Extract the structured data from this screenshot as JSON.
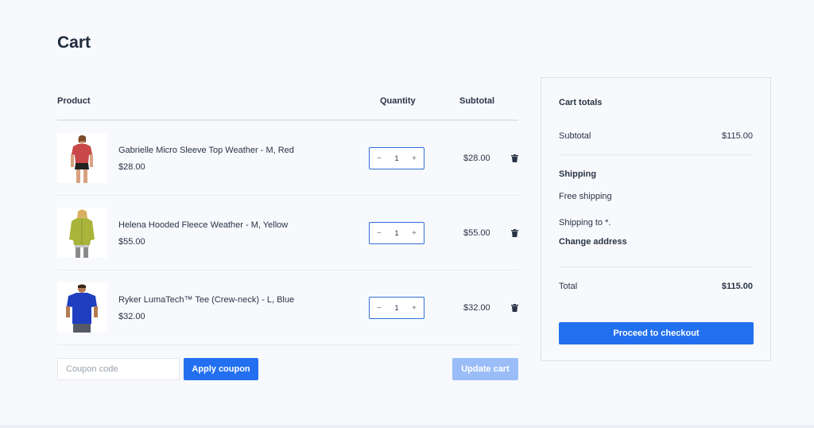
{
  "page": {
    "title": "Cart"
  },
  "table": {
    "headers": {
      "product": "Product",
      "quantity": "Quantity",
      "subtotal": "Subtotal"
    },
    "items": [
      {
        "name": "Gabrielle Micro Sleeve Top Weather - M, Red",
        "price": "$28.00",
        "quantity": "1",
        "subtotal": "$28.00",
        "color": "#c9484a"
      },
      {
        "name": "Helena Hooded Fleece Weather - M, Yellow",
        "price": "$55.00",
        "quantity": "1",
        "subtotal": "$55.00",
        "color": "#a9b43a"
      },
      {
        "name": "Ryker LumaTech™ Tee (Crew-neck) - L, Blue",
        "price": "$32.00",
        "quantity": "1",
        "subtotal": "$32.00",
        "color": "#1f3fc0"
      }
    ],
    "stepper": {
      "minus": "−",
      "plus": "+"
    }
  },
  "coupon": {
    "placeholder": "Coupon code",
    "apply_label": "Apply coupon"
  },
  "update_label": "Update cart",
  "totals": {
    "title": "Cart totals",
    "subtotal_label": "Subtotal",
    "subtotal_value": "$115.00",
    "shipping_label": "Shipping",
    "shipping_method": "Free shipping",
    "shipping_to": "Shipping to *.",
    "change_address": "Change address",
    "total_label": "Total",
    "total_value": "$115.00",
    "checkout_label": "Proceed to checkout"
  },
  "colors": {
    "accent": "#2270f0",
    "disabled": "#9bbdf7"
  },
  "icons": {
    "remove": "trash-icon"
  }
}
